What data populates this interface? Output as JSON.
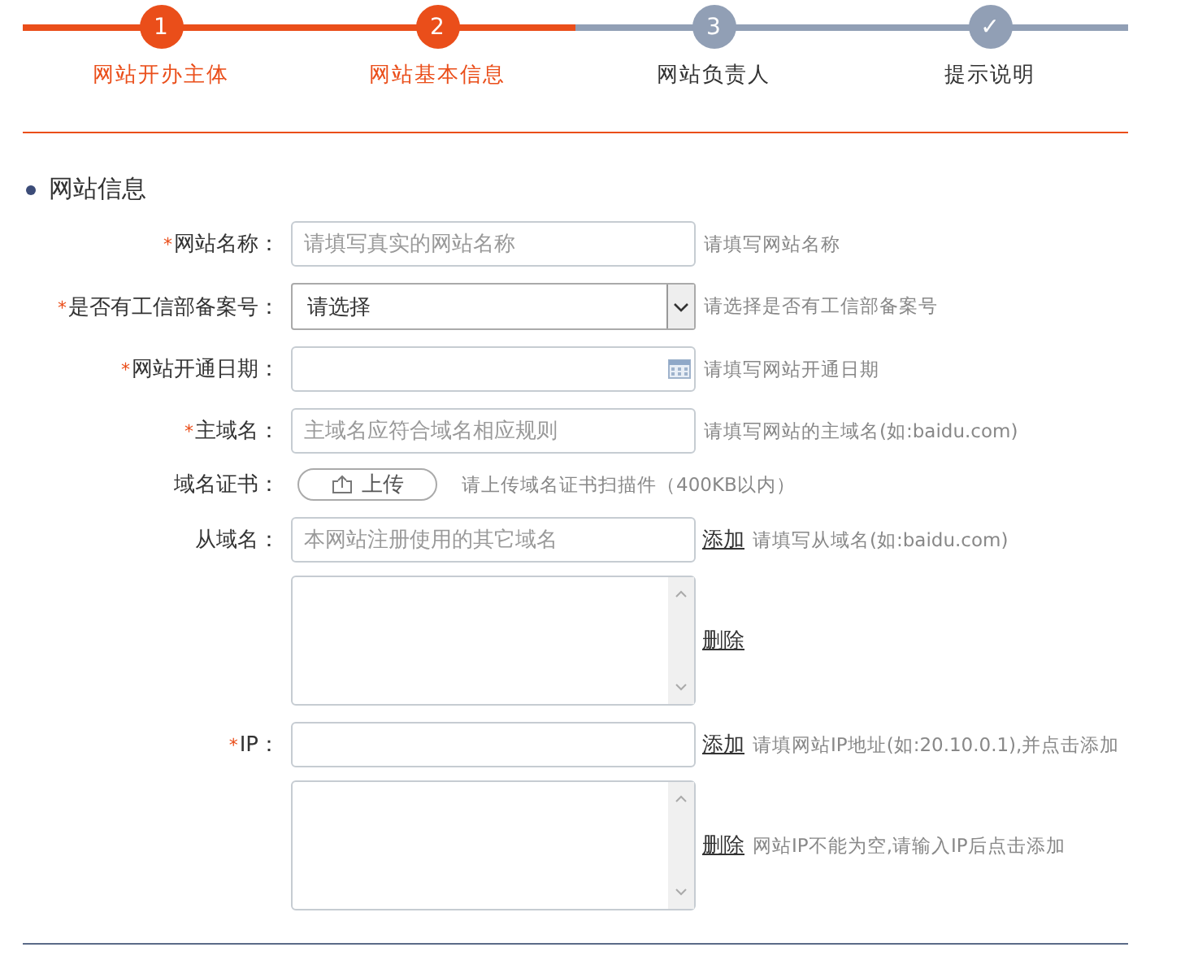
{
  "steps": [
    {
      "number": "1",
      "label": "网站开办主体",
      "completed": true
    },
    {
      "number": "2",
      "label": "网站基本信息",
      "completed": true
    },
    {
      "number": "3",
      "label": "网站负责人",
      "completed": false
    },
    {
      "number": "✓",
      "label": "提示说明",
      "completed": false
    }
  ],
  "section_title": "网站信息",
  "rows": [
    {
      "kind": "text",
      "marker": "*",
      "label": "网站名称：",
      "placeholder": "请填写真实的网站名称",
      "hint": "请填写网站名称"
    },
    {
      "kind": "select",
      "marker": "*",
      "label": "是否有工信部备案号：",
      "value": "请选择",
      "hint": "请选择是否有工信部备案号"
    },
    {
      "kind": "date",
      "marker": "*",
      "label": "网站开通日期：",
      "hint": "请填写网站开通日期"
    },
    {
      "kind": "text",
      "marker": "*",
      "label": "主域名：",
      "placeholder": "主域名应符合域名相应规则",
      "hint": "请填写网站的主域名(如:baidu.com)"
    },
    {
      "kind": "upload",
      "label": "域名证书：",
      "button": "上传",
      "hint": "请上传域名证书扫描件（400KB以内）"
    },
    {
      "kind": "text",
      "label": "从域名：",
      "placeholder": "本网站注册使用的其它域名",
      "link": "添加",
      "hint": "请填写从域名(如:baidu.com)"
    },
    {
      "kind": "list",
      "link": "删除"
    },
    {
      "kind": "text",
      "marker": "*",
      "label": "IP：",
      "link": "添加",
      "hint": "请填网站IP地址(如:20.10.0.1),并点击添加"
    },
    {
      "kind": "list",
      "link": "删除",
      "hint": "网站IP不能为空,请输入IP后点击添加"
    }
  ]
}
